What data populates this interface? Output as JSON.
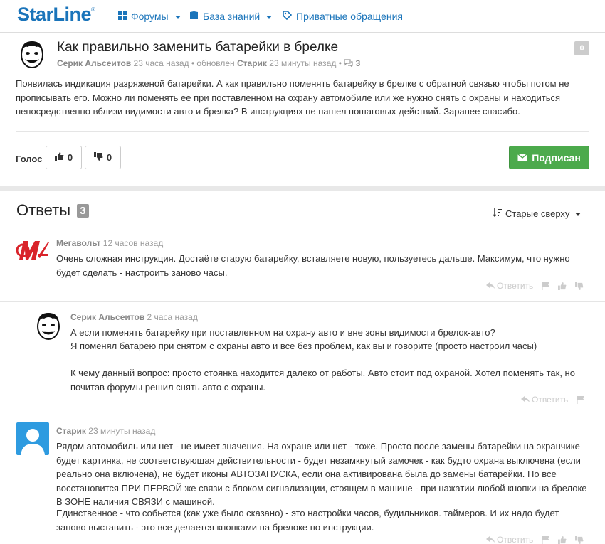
{
  "brand": {
    "logo_text": "StarLine",
    "logo_mark": "®",
    "color": "#1a74ba"
  },
  "nav": [
    {
      "label": "Форумы",
      "icon": "grid-icon",
      "dropdown": true
    },
    {
      "label": "База знаний",
      "icon": "book-icon",
      "dropdown": true
    },
    {
      "label": "Приватные обращения",
      "icon": "tag-icon",
      "dropdown": false
    }
  ],
  "question": {
    "title": "Как правильно заменить батарейки в брелке",
    "author": "Серик Альсеитов",
    "time": "23 часа назад",
    "updated_prefix": "• обновлен",
    "updated_by": "Старик",
    "updated_time": "23 минуты назад",
    "comments_count": "3",
    "score": "0",
    "body": "Появилась индикация разряженой батарейки. А как правильно поменять батарейку в брелке с обратной связью чтобы потом не прописывать его. Можно ли поменять ее при поставленном на охрану автомобиле или же нужно снять с охраны и находиться непосредственно вблизи видимости авто и брелка? В инструкциях не нашел пошаговых действий. Заранее спасибо.",
    "vote_label": "Голос",
    "upvotes": "0",
    "downvotes": "0",
    "subscribe_label": "Подписан"
  },
  "answers": {
    "title": "Ответы",
    "count": "3",
    "sort_label": "Старые сверху",
    "reply_label": "Ответить",
    "items": [
      {
        "author": "Мегавольт",
        "time": "12 часов назад",
        "text": "Очень сложная инструкция. Достаёте старую батарейку, вставляете новую, пользуетесь дальше. Максимум, что нужно будет сделать - настроить заново часы."
      },
      {
        "author": "Серик Альсеитов",
        "time": "2 часа назад",
        "text1": "А если поменять батарейку при поставленном на охрану авто и вне зоны видимости брелок-авто?",
        "text2": "Я поменял батарею при снятом с охраны авто и все без проблем, как вы и говорите (просто настроил часы)",
        "text3": "К чему данный вопрос: просто стоянка находится далеко от работы. Авто стоит под охраной. Хотел поменять так, но почитав форумы решил снять авто с охраны."
      },
      {
        "author": "Старик",
        "time": "23 минуты назад",
        "text1": "Рядом автомобиль или нет - не имеет значения. На охране или нет - тоже. Просто после замены батарейки на экранчике будет картинка, не соответствующая действительности  - будет незамкнутый замочек - как будто охрана выключена (если реально она включена), не будет иконы АВТОЗАПУСКА, если она активирована была до замены батарейки. Но все восстановится ПРИ ПЕРВОЙ же связи с блоком сигнализации, стоящем в машине - при нажатии любой кнопки на брелоке В ЗОНЕ наличия  СВЯЗИ с машиной.",
        "text2": "Единственное - что собьется (как уже было сказано) - это настройки часов, будильников. таймеров. И их надо будет заново выставить - это все делается кнопками на брелоке по инструкции."
      }
    ]
  },
  "colors": {
    "accent": "#1a74ba",
    "success": "#4caa4c",
    "muted": "#999999"
  }
}
